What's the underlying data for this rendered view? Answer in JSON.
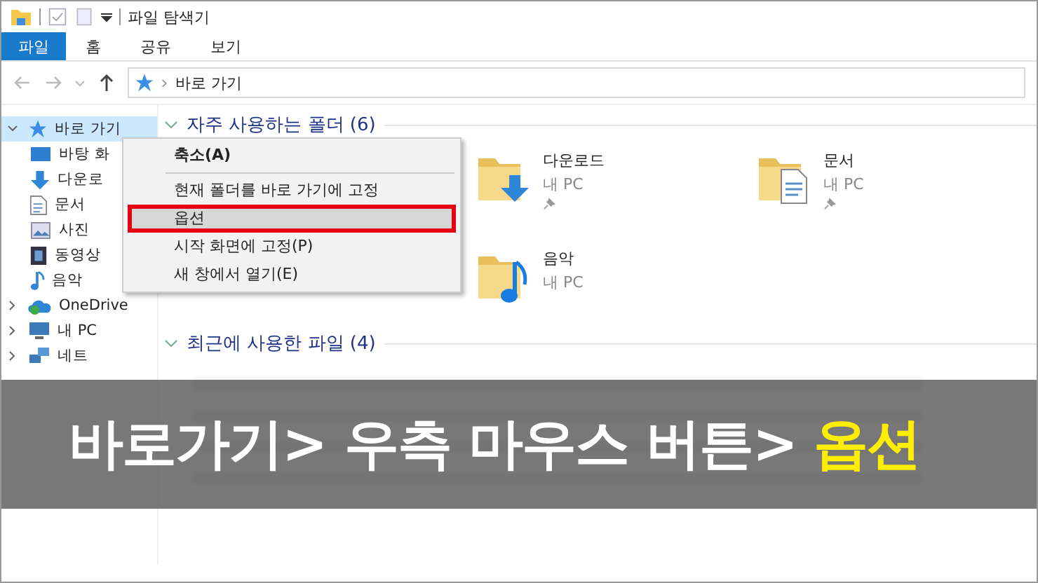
{
  "window": {
    "title": "파일 탐색기"
  },
  "ribbon_tabs": [
    {
      "label": "파일",
      "selected": true
    },
    {
      "label": "홈",
      "selected": false
    },
    {
      "label": "공유",
      "selected": false
    },
    {
      "label": "보기",
      "selected": false
    }
  ],
  "address_bar": {
    "path": "바로 가기"
  },
  "sidebar": {
    "items": [
      {
        "label": "바로 가기",
        "kind": "star",
        "selected": true,
        "expanded": true,
        "children": [
          {
            "label": "바탕 화",
            "kind": "desktop",
            "selected": false
          },
          {
            "label": "다운로",
            "kind": "download",
            "selected": false
          },
          {
            "label": "문서",
            "kind": "document",
            "selected": false
          },
          {
            "label": "사진",
            "kind": "picture",
            "selected": false
          },
          {
            "label": "동영상",
            "kind": "video",
            "selected": false
          },
          {
            "label": "음악",
            "kind": "music",
            "selected": false
          }
        ]
      },
      {
        "label": "OneDrive",
        "kind": "cloud",
        "selected": false,
        "expanded": false
      },
      {
        "label": "내 PC",
        "kind": "pc",
        "selected": false,
        "expanded": false
      },
      {
        "label": "네트",
        "kind": "network",
        "selected": false,
        "expanded": false
      }
    ]
  },
  "frequent_folders": {
    "header": "자주 사용하는 폴더 (6)",
    "items": [
      {
        "name": "다운로드",
        "location": "내 PC",
        "kind": "download",
        "pinned": true
      },
      {
        "name": "문서",
        "location": "내 PC",
        "kind": "document",
        "pinned": true
      },
      {
        "name": "음악",
        "location": "내 PC",
        "kind": "music",
        "pinned": false
      }
    ]
  },
  "recent_files": {
    "header": "최근에 사용한 파일 (4)"
  },
  "context_menu": {
    "items": [
      {
        "kind": "item",
        "label": "축소(A)",
        "selected": false,
        "bold": true
      },
      {
        "kind": "separator"
      },
      {
        "kind": "item",
        "label": "현재 폴더를 바로 가기에 고정",
        "selected": false,
        "bold": false
      },
      {
        "kind": "item",
        "label": "옵션",
        "selected": true,
        "bold": false
      },
      {
        "kind": "item",
        "label": "시작 화면에 고정(P)",
        "selected": false,
        "bold": false
      },
      {
        "kind": "item",
        "label": "새 창에서 열기(E)",
        "selected": false,
        "bold": false
      }
    ]
  },
  "banner": {
    "text": "바로가기> 우측 마우스 버튼>",
    "highlight": "옵션"
  }
}
